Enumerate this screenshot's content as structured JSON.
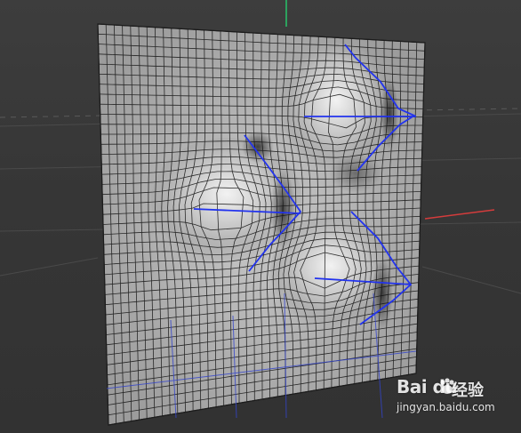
{
  "viewport": {
    "background": "#3a3a3a",
    "plane_color": "#aeaeae",
    "mesh_line_color": "#111111",
    "spline_color": "#2233ee",
    "axis_y_color": "#27c46a",
    "axis_x_color": "#d43c3c"
  },
  "watermark": {
    "logo_text": "Bai du",
    "title": "经验",
    "url": "jingyan.baidu.com",
    "icon": "baidu-paw-icon"
  }
}
